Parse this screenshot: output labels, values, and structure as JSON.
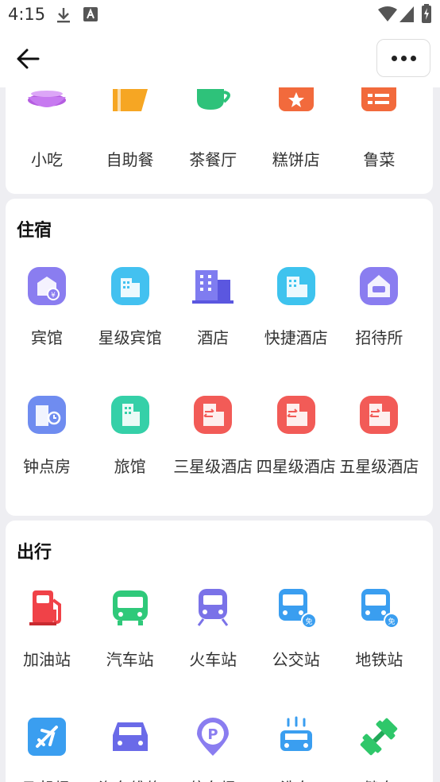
{
  "status_bar": {
    "time": "4:15"
  },
  "top_section": {
    "items": [
      {
        "label": "小吃",
        "icon": "snack-icon"
      },
      {
        "label": "自助餐",
        "icon": "buffet-icon"
      },
      {
        "label": "茶餐厅",
        "icon": "tea-restaurant-icon"
      },
      {
        "label": "糕饼店",
        "icon": "bakery-icon"
      },
      {
        "label": "鲁菜",
        "icon": "shandong-cuisine-icon"
      }
    ]
  },
  "lodging": {
    "title": "住宿",
    "items": [
      {
        "label": "宾馆",
        "icon": "guesthouse-icon",
        "color": "#8a7df0"
      },
      {
        "label": "星级宾馆",
        "icon": "star-hotel-icon",
        "color": "#43c1f0"
      },
      {
        "label": "酒店",
        "icon": "hotel-icon",
        "color": "#7f7cf0"
      },
      {
        "label": "快捷酒店",
        "icon": "express-hotel-icon",
        "color": "#3ec3ee"
      },
      {
        "label": "招待所",
        "icon": "hostel-icon",
        "color": "#8a7df0"
      },
      {
        "label": "钟点房",
        "icon": "hourly-room-icon",
        "color": "#6f8cf0"
      },
      {
        "label": "旅馆",
        "icon": "inn-icon",
        "color": "#35d0a8"
      },
      {
        "label": "三星级酒店",
        "icon": "three-star-hotel-icon",
        "color": "#f25b57"
      },
      {
        "label": "四星级酒店",
        "icon": "four-star-hotel-icon",
        "color": "#f25b57"
      },
      {
        "label": "五星级酒店",
        "icon": "five-star-hotel-icon",
        "color": "#f25b57"
      }
    ]
  },
  "travel": {
    "title": "出行",
    "items": [
      {
        "label": "加油站",
        "icon": "gas-station-icon",
        "color": "#f04248"
      },
      {
        "label": "汽车站",
        "icon": "bus-station-icon",
        "color": "#2fc97a"
      },
      {
        "label": "火车站",
        "icon": "train-station-icon",
        "color": "#7a72e8"
      },
      {
        "label": "公交站",
        "icon": "bus-stop-icon",
        "color": "#3a9ef0"
      },
      {
        "label": "地铁站",
        "icon": "subway-station-icon",
        "color": "#3a9ef0"
      },
      {
        "label": "飞机场",
        "icon": "airport-icon",
        "color": "#3a9ef0"
      },
      {
        "label": "汽车维修",
        "icon": "car-repair-icon",
        "color": "#6a6ae8"
      },
      {
        "label": "停车场",
        "icon": "parking-icon",
        "color": "#8a7df0"
      },
      {
        "label": "洗车",
        "icon": "car-wash-icon",
        "color": "#3a9ef0"
      },
      {
        "label": "健身",
        "icon": "fitness-icon",
        "color": "#2fc76a"
      }
    ]
  }
}
